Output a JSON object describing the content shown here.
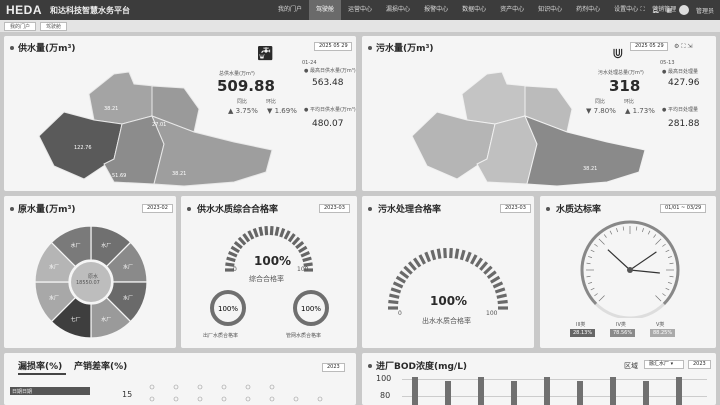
{
  "app": {
    "logo": "HEDA",
    "title": "和达科技智慧水务平台"
  },
  "nav": [
    "我的门户",
    "驾驶舱",
    "运营中心",
    "漏损中心",
    "报警中心",
    "数据中心",
    "资产中心",
    "知识中心",
    "药剂中心",
    "设置中心",
    "营销管理"
  ],
  "nav_active_index": 1,
  "user": {
    "name": "管理员"
  },
  "tabs": [
    "我的门户",
    "驾驶舱"
  ],
  "supply": {
    "title": "供水量(万m³)",
    "date": "2025 05 29",
    "total_label": "总供水量(万m³)",
    "total": "509.88",
    "avg_date": "01-24",
    "avg_label": "最高日供水量(万m³)",
    "avg": "563.48",
    "yoy_label": "同比",
    "yoy": "3.75%",
    "mom_label": "环比",
    "mom": "1.69%",
    "avg2_label": "平均日供水量(万m³)",
    "avg2": "480.07",
    "regions": [
      "122.76",
      "38.21",
      "27.01",
      "51.69",
      "38.21"
    ]
  },
  "sewage": {
    "title": "污水量(万m³)",
    "date": "2025 05 29",
    "total_label": "污水处理总量(万m³)",
    "total": "318",
    "avg_date": "05-13",
    "avg_label": "最高日处理量",
    "avg": "427.96",
    "yoy_label": "同比",
    "yoy": "7.80%",
    "mom_label": "环比",
    "mom": "1.73%",
    "avg2_label": "平均日处理量",
    "avg2": "281.88",
    "regions": [
      "38.21"
    ]
  },
  "raw": {
    "title": "原水量(万m³)",
    "date": "2023-02",
    "center_label": "原水",
    "center_value": "18550.07",
    "segments": [
      "水厂",
      "水厂",
      "水厂",
      "水厂",
      "七厂",
      "水厂",
      "水厂",
      "水厂"
    ]
  },
  "quality": {
    "title": "供水水质综合合格率",
    "date": "2023-03",
    "main_value": "100%",
    "main_label": "综合合格率",
    "gauge_min": "0",
    "gauge_max": "100",
    "rings": [
      {
        "value": "100%",
        "label": "出厂水质合格率"
      },
      {
        "value": "100%",
        "label": "管网水质合格率"
      }
    ]
  },
  "treatment": {
    "title": "污水处理合格率",
    "date": "2023-03",
    "value": "100%",
    "label": "出水水质合格率",
    "gauge_min": "0",
    "gauge_max": "100"
  },
  "standard": {
    "title": "水质达标率",
    "date": "01/01 ~ 03/29",
    "classes": [
      {
        "name": "III类",
        "value": "28.13%"
      },
      {
        "name": "IV类",
        "value": "78.56%"
      },
      {
        "name": "V类",
        "value": "88.25%"
      }
    ]
  },
  "leak": {
    "title": "漏损率(%)",
    "title2": "产销差率(%)",
    "date": "2023",
    "row_label": "日期日期",
    "y_tick": "15"
  },
  "bod": {
    "title": "进厂BOD浓度(mg/L)",
    "region_label": "区域",
    "region_value": "融汇水厂",
    "date": "2023",
    "y_ticks": [
      "100",
      "80"
    ]
  }
}
